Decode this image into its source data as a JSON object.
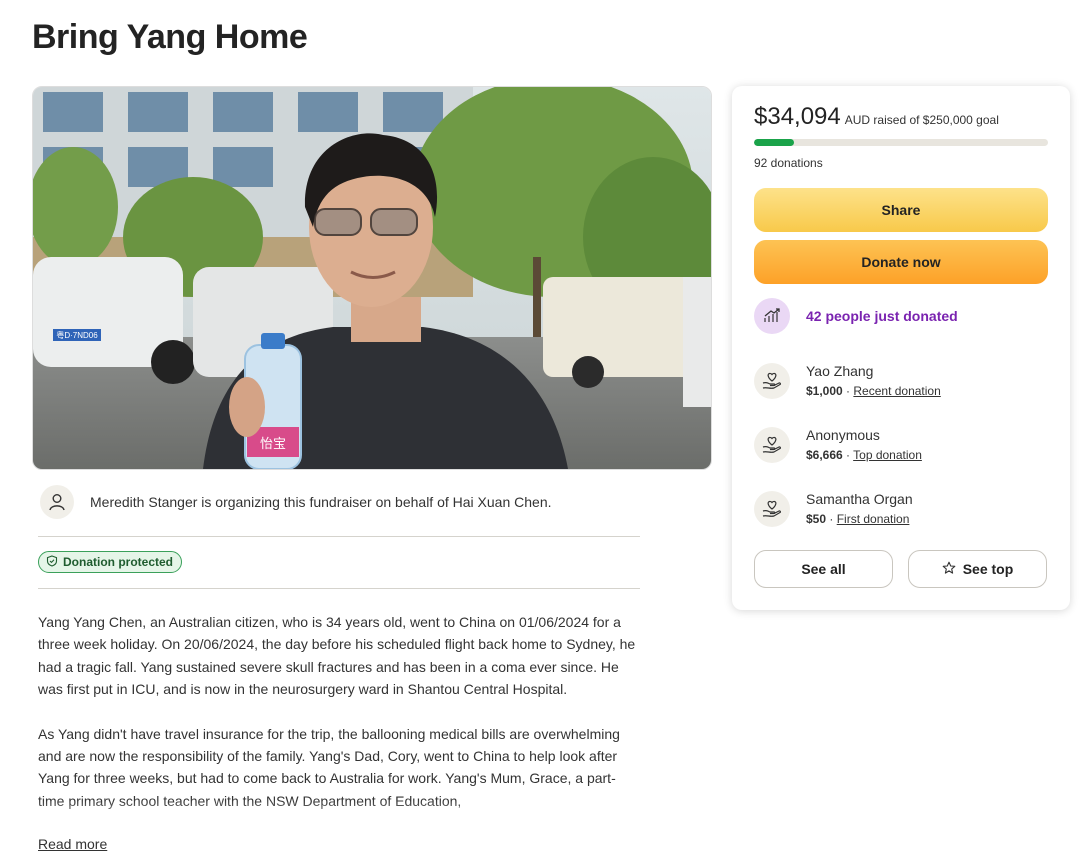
{
  "page": {
    "title": "Bring Yang Home"
  },
  "organizer": {
    "text": "Meredith Stanger is organizing this fundraiser on behalf of Hai Xuan Chen."
  },
  "badge": {
    "label": "Donation protected"
  },
  "story": {
    "paragraphs": [
      "Yang Yang Chen, an Australian citizen, who is 34 years old, went to China on 01/06/2024 for a three week holiday. On 20/06/2024, the day before his scheduled flight back home to Sydney, he had a tragic fall. Yang sustained severe skull fractures and has been in a coma ever since. He was first put in ICU, and is now in the neurosurgery ward in Shantou Central Hospital.",
      "As Yang didn't have travel insurance for the trip, the ballooning medical bills are overwhelming and are now the responsibility of the family. Yang's Dad, Cory, went to China to help look after Yang for three weeks, but had to come back to Australia for work. Yang's Mum, Grace, a part-time primary school teacher with the NSW Department of Education,"
    ],
    "read_more": "Read more"
  },
  "hero": {
    "plate_text": "粤D·7ND06",
    "bottle_text": "怡宝"
  },
  "donate_card": {
    "amount": "$34,094",
    "raised_text": "AUD raised of $250,000 goal",
    "progress_fraction": 0.136,
    "donations": "92 donations",
    "share_label": "Share",
    "donate_label": "Donate now",
    "trend_text": "42 people just donated",
    "donors": [
      {
        "name": "Yao Zhang",
        "amount": "$1,000",
        "tag": "Recent donation"
      },
      {
        "name": "Anonymous",
        "amount": "$6,666",
        "tag": "Top donation"
      },
      {
        "name": "Samantha Organ",
        "amount": "$50",
        "tag": "First donation"
      }
    ],
    "see_all_label": "See all",
    "see_top_label": "See top"
  },
  "colors": {
    "progress": "#1aa34a",
    "trend_text": "#7a23b0",
    "share_btn": "#f9cf55",
    "donate_btn": "#fdb13c",
    "protected_border": "#3aa05a"
  }
}
